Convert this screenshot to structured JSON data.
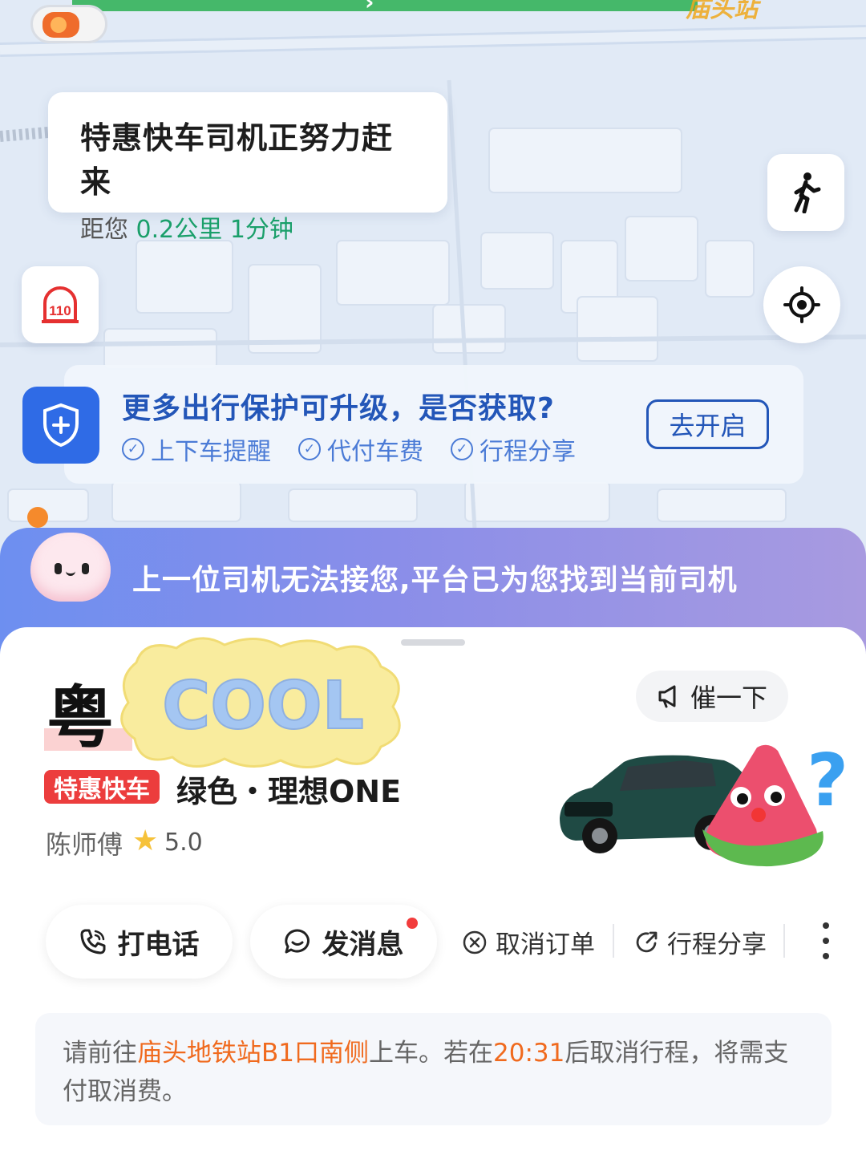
{
  "map": {
    "route_color": "#45b86a",
    "destination_label": "庙头站",
    "status": {
      "title": "特惠快车司机正努力赶来",
      "distance_prefix": "距您",
      "distance": "0.2公里",
      "eta": "1分钟"
    },
    "buttons": {
      "walk_icon": "walking-person-icon",
      "locate_icon": "crosshair-icon",
      "police_label": "110"
    },
    "protection": {
      "title": "更多出行保护可升级，是否获取?",
      "items": [
        "上下车提醒",
        "代付车费",
        "行程分享"
      ],
      "action": "去开启",
      "accent": "#2356b8"
    }
  },
  "banner": {
    "text": "上一位司机无法接您,平台已为您找到当前司机"
  },
  "driver": {
    "plate_visible": "粤",
    "sticker_text": "COOL",
    "remind_label": "催一下",
    "service_tag": "特惠快车",
    "car_desc": "绿色・理想ONE",
    "name": "陈师傅",
    "rating": "5.0"
  },
  "actions": {
    "call": "打电话",
    "message": "发消息",
    "cancel": "取消订单",
    "share": "行程分享"
  },
  "notice": {
    "prefix": "请前往",
    "location": "庙头地铁站B1口南侧",
    "mid": "上车。若在",
    "time": "20:31",
    "suffix": "后取消行程，将需支付取消费。"
  }
}
